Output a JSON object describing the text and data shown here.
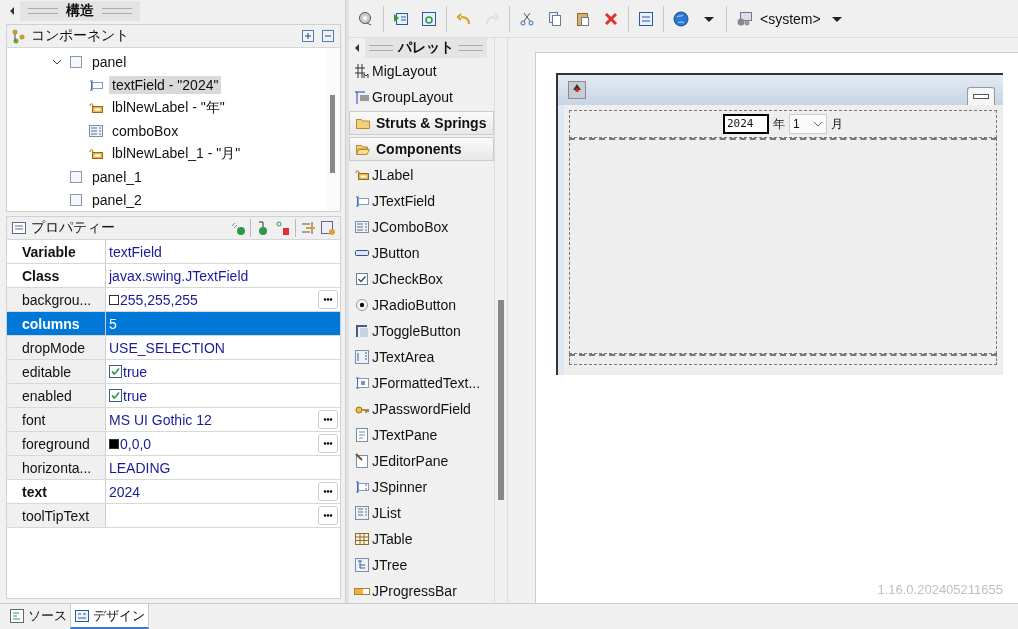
{
  "structure": {
    "title": "構造"
  },
  "components": {
    "title": "コンポーネント",
    "tree": [
      {
        "label": "panel",
        "kind": "panel",
        "expanded": true,
        "selected": false,
        "children": [
          {
            "label": "textField - \"2024\"",
            "kind": "textfield",
            "selected": true
          },
          {
            "label": "lblNewLabel - \"年\"",
            "kind": "label",
            "selected": false
          },
          {
            "label": "comboBox",
            "kind": "combo",
            "selected": false
          },
          {
            "label": "lblNewLabel_1 - \"月\"",
            "kind": "label",
            "selected": false
          }
        ]
      },
      {
        "label": "panel_1",
        "kind": "panel",
        "selected": false
      },
      {
        "label": "panel_2",
        "kind": "panel",
        "selected": false
      }
    ]
  },
  "properties": {
    "title": "プロパティー",
    "rows": [
      {
        "name": "Variable",
        "value": "textField",
        "kind": "text",
        "bold": true,
        "selected": false,
        "button": false
      },
      {
        "name": "Class",
        "value": "javax.swing.JTextField",
        "kind": "text",
        "bold": true,
        "selected": false,
        "button": false
      },
      {
        "name": "backgrou...",
        "value": "255,255,255",
        "kind": "color",
        "color": "#ffffff",
        "bold": false,
        "selected": false,
        "button": true
      },
      {
        "name": "columns",
        "value": "5",
        "kind": "text",
        "bold": true,
        "selected": true,
        "button": false
      },
      {
        "name": "dropMode",
        "value": "USE_SELECTION",
        "kind": "text",
        "bold": false,
        "selected": false,
        "button": false
      },
      {
        "name": "editable",
        "value": "true",
        "kind": "check",
        "checked": true,
        "bold": false,
        "selected": false,
        "button": false
      },
      {
        "name": "enabled",
        "value": "true",
        "kind": "check",
        "checked": true,
        "bold": false,
        "selected": false,
        "button": false
      },
      {
        "name": "font",
        "value": "MS UI Gothic 12",
        "kind": "text",
        "bold": false,
        "selected": false,
        "button": true
      },
      {
        "name": "foreground",
        "value": "0,0,0",
        "kind": "color",
        "color": "#000000",
        "bold": false,
        "selected": false,
        "button": true
      },
      {
        "name": "horizonta...",
        "value": "LEADING",
        "kind": "text",
        "bold": false,
        "selected": false,
        "button": false
      },
      {
        "name": "text",
        "value": "2024",
        "kind": "text",
        "bold": true,
        "selected": false,
        "button": true
      },
      {
        "name": "toolTipText",
        "kind": "text",
        "bold": false,
        "selected": false,
        "button": true
      }
    ]
  },
  "toolbar": {
    "groups": [
      [
        {
          "kind": "test",
          "disabled": false
        }
      ],
      [
        {
          "kind": "play",
          "disabled": false
        },
        {
          "kind": "refresh",
          "disabled": false
        }
      ],
      [
        {
          "kind": "undo",
          "disabled": false
        },
        {
          "kind": "redo",
          "disabled": true
        }
      ],
      [
        {
          "kind": "cut",
          "disabled": false
        },
        {
          "kind": "copy",
          "disabled": false
        },
        {
          "kind": "paste",
          "disabled": false
        },
        {
          "kind": "delete",
          "disabled": false
        }
      ],
      [
        {
          "kind": "order",
          "disabled": false
        }
      ],
      [
        {
          "kind": "globe",
          "disabled": false
        },
        {
          "kind": "caret",
          "disabled": false
        }
      ]
    ],
    "laf": "<system>"
  },
  "palette": {
    "title": "パレット",
    "items": [
      {
        "label": "MigLayout",
        "kind": "mig"
      },
      {
        "label": "GroupLayout",
        "kind": "group"
      },
      {
        "label": "Struts & Springs",
        "kind": "category",
        "expanded": false
      },
      {
        "label": "Components",
        "kind": "category",
        "expanded": true
      },
      {
        "label": "JLabel",
        "kind": "label"
      },
      {
        "label": "JTextField",
        "kind": "textfield"
      },
      {
        "label": "JComboBox",
        "kind": "combo"
      },
      {
        "label": "JButton",
        "kind": "button"
      },
      {
        "label": "JCheckBox",
        "kind": "checkbox"
      },
      {
        "label": "JRadioButton",
        "kind": "radio"
      },
      {
        "label": "JToggleButton",
        "kind": "toggle"
      },
      {
        "label": "JTextArea",
        "kind": "textarea"
      },
      {
        "label": "JFormattedText...",
        "kind": "formatted"
      },
      {
        "label": "JPasswordField",
        "kind": "password"
      },
      {
        "label": "JTextPane",
        "kind": "textpane"
      },
      {
        "label": "JEditorPane",
        "kind": "editor"
      },
      {
        "label": "JSpinner",
        "kind": "spinner"
      },
      {
        "label": "JList",
        "kind": "list"
      },
      {
        "label": "JTable",
        "kind": "table"
      },
      {
        "label": "JTree",
        "kind": "tree"
      },
      {
        "label": "JProgressBar",
        "kind": "progress"
      }
    ]
  },
  "design": {
    "text_field": "2024",
    "year_label": "年",
    "combo_value": "1",
    "month_label": "月"
  },
  "version": "1.16.0.202405211655",
  "editor_tabs": [
    {
      "label": "ソース",
      "kind": "source",
      "selected": false
    },
    {
      "label": "デザイン",
      "kind": "design",
      "selected": true
    }
  ]
}
